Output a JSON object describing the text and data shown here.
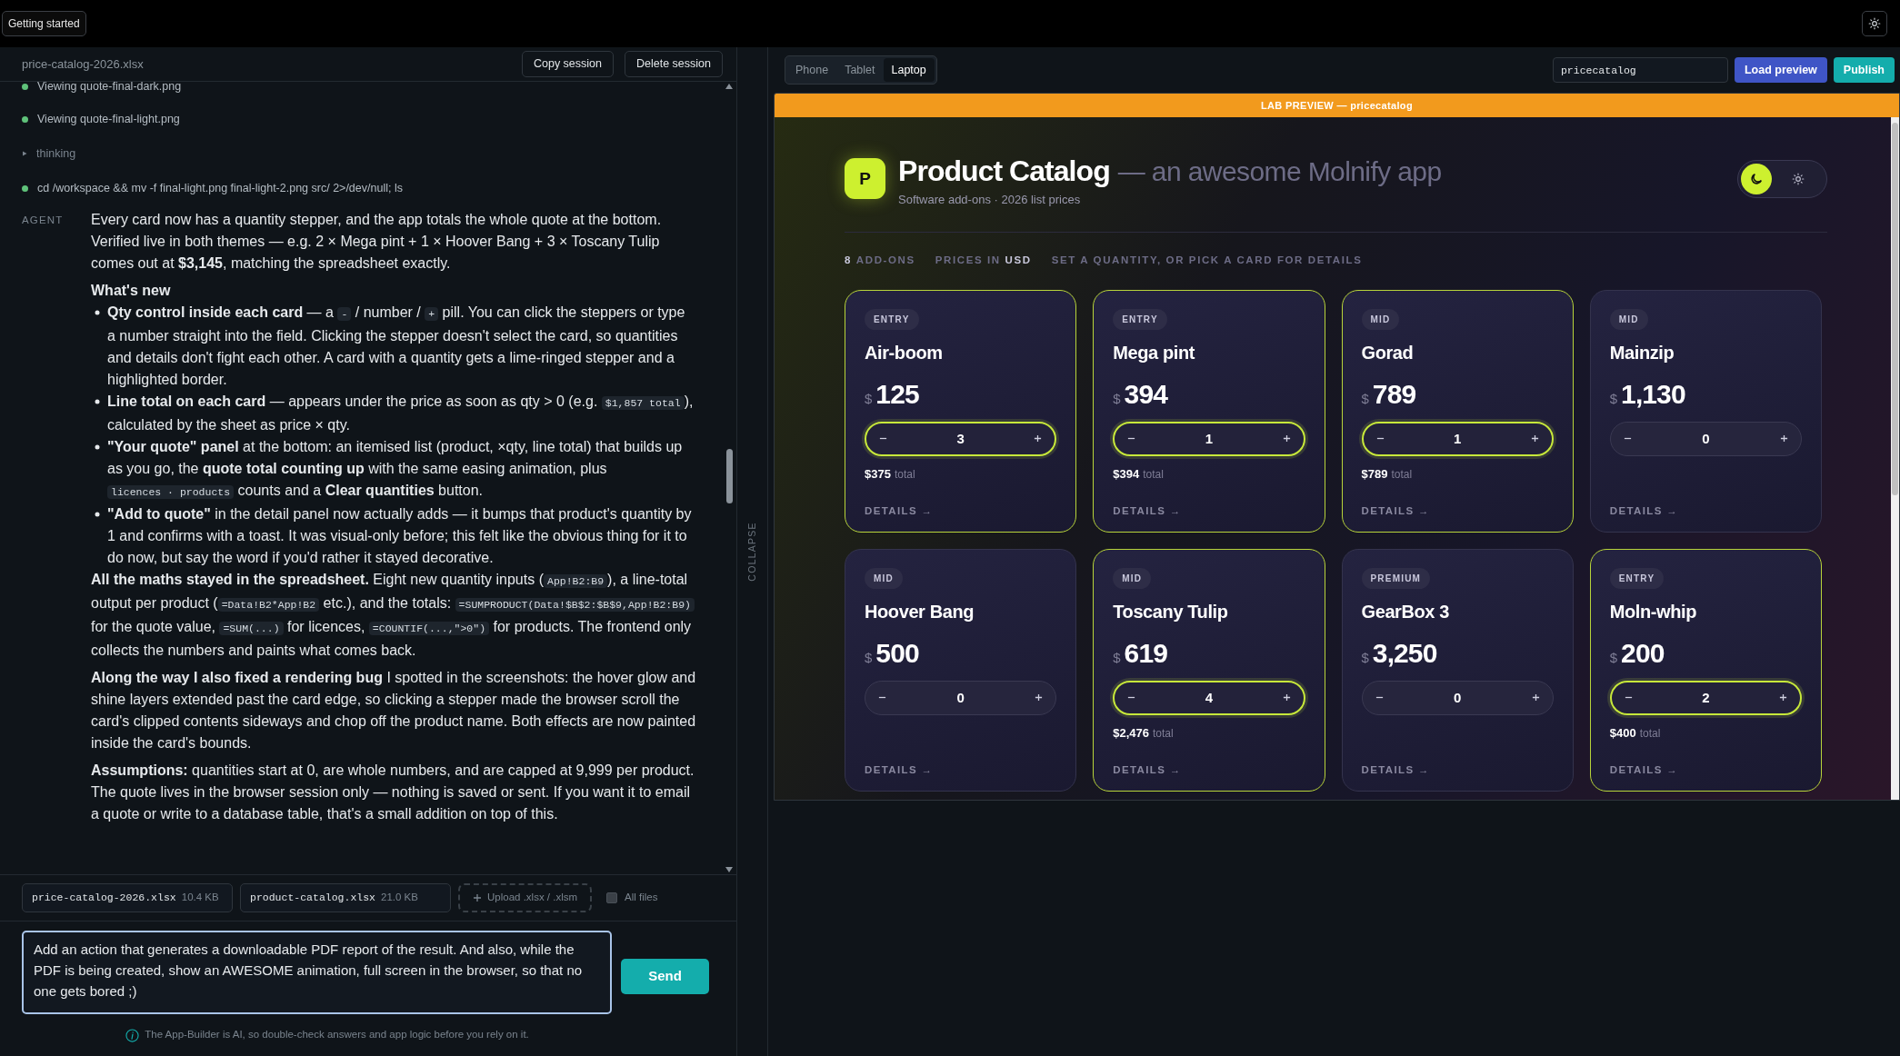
{
  "top_bar": {
    "guide_button": "Getting started"
  },
  "session": {
    "file_name": "price-catalog-2026.xlsx",
    "buttons": [
      "Copy session",
      "Delete session"
    ]
  },
  "chat": {
    "steps": [
      {
        "kind": "tool",
        "text": "Viewing quote-final-dark.png"
      },
      {
        "kind": "tool",
        "text": "Viewing quote-final-light.png"
      },
      {
        "kind": "thinking",
        "text": "thinking"
      },
      {
        "kind": "tool",
        "text": "cd /workspace && mv -f final-light.png final-light-2.png src/ 2>/dev/null; ls"
      }
    ],
    "agent_label": "AGENT",
    "blocks": [
      {
        "kind": "paragraph",
        "segments": [
          {
            "kind": "text",
            "text": "Every card now has a quantity stepper, and the app totals the whole quote at the bottom. Verified live in both themes — e.g. 2 × Mega pint + 1 × Hoover Bang + 3 × Toscany Tulip comes out at **$3,145**, matching the spreadsheet exactly."
          }
        ]
      },
      {
        "kind": "heading",
        "text": "What's new"
      },
      {
        "kind": "list",
        "items": [
          {
            "segments": [
              {
                "kind": "text",
                "text": "**Qty control inside each card** — a "
              },
              {
                "kind": "code",
                "text": "-"
              },
              {
                "kind": "text",
                "text": " / number / "
              },
              {
                "kind": "code",
                "text": "+"
              },
              {
                "kind": "text",
                "text": " pill. You can click the steppers or type a number straight into the field. Clicking the stepper doesn't select the card, so quantities and details don't fight each other. A card with a quantity gets a lime-ringed stepper and a highlighted border."
              }
            ]
          },
          {
            "segments": [
              {
                "kind": "text",
                "text": "**Line total on each card** — appears under the price as soon as qty > 0 (e.g. "
              },
              {
                "kind": "code",
                "text": "$1,857 total"
              },
              {
                "kind": "text",
                "text": "), calculated by the sheet as price × qty."
              }
            ]
          },
          {
            "segments": [
              {
                "kind": "text",
                "text": "**\"Your quote\" panel** at the bottom: an itemised list (product, ×qty, line total) that builds up as you go, the **quote total counting up** with the same easing animation, plus "
              },
              {
                "kind": "code",
                "text": "licences · products"
              },
              {
                "kind": "text",
                "text": " counts and a **Clear quantities** button."
              }
            ]
          },
          {
            "segments": [
              {
                "kind": "text",
                "text": "**\"Add to quote\"** in the detail panel now actually adds — it bumps that product's quantity by 1 and confirms with a toast. It was visual-only before; this felt like the obvious thing for it to do now, but say the word if you'd rather it stayed decorative."
              }
            ]
          }
        ]
      },
      {
        "kind": "paragraph",
        "segments": [
          {
            "kind": "text",
            "text": "**All the maths stayed in the spreadsheet.** Eight new quantity inputs ("
          },
          {
            "kind": "code",
            "text": "App!B2:B9"
          },
          {
            "kind": "text",
            "text": "), a line-total output per product ("
          },
          {
            "kind": "code",
            "text": "=Data!B2*App!B2"
          },
          {
            "kind": "text",
            "text": " etc.), and the totals: "
          },
          {
            "kind": "code",
            "text": "=SUMPRODUCT(Data!$B$2:$B$9,App!B2:B9)"
          },
          {
            "kind": "text",
            "text": " for the quote value, "
          },
          {
            "kind": "code",
            "text": "=SUM(...)"
          },
          {
            "kind": "text",
            "text": " for licences, "
          },
          {
            "kind": "code",
            "text": "=COUNTIF(...,\">0\")"
          },
          {
            "kind": "text",
            "text": " for products. The frontend only collects the numbers and paints what comes back."
          }
        ]
      },
      {
        "kind": "paragraph",
        "segments": [
          {
            "kind": "text",
            "text": "**Along the way I also fixed a rendering bug** I spotted in the screenshots: the hover glow and shine layers extended past the card edge, so clicking a stepper made the browser scroll the card's clipped contents sideways and chop off the product name. Both effects are now painted inside the card's bounds."
          }
        ]
      },
      {
        "kind": "paragraph",
        "segments": [
          {
            "kind": "text",
            "text": "**Assumptions:** quantities start at 0, are whole numbers, and are capped at 9,999 per product. The quote lives in the browser session only — nothing is saved or sent. If you want it to email a quote or write to a database table, that's a small addition on top of this."
          }
        ]
      }
    ]
  },
  "files": [
    {
      "name": "price-catalog-2026.xlsx",
      "size": "10.4 KB"
    },
    {
      "name": "product-catalog.xlsx",
      "size": "21.0 KB"
    }
  ],
  "upload": "Upload .xlsx / .xlsm",
  "all_files": {
    "label": "All files",
    "checked": false
  },
  "composer": {
    "value": "Add an action that generates a downloadable PDF report of the result. And also, while the PDF is being created, show an AWESOME animation, full screen in the browser, so that no one gets bored ;)",
    "send": "Send"
  },
  "disclaimer": "The App-Builder is AI, so double-check answers and app logic before you rely on it.",
  "collapse": "COLLAPSE",
  "preview_toolbar": {
    "devices": [
      {
        "label": "Phone",
        "selected": false
      },
      {
        "label": "Tablet",
        "selected": false
      },
      {
        "label": "Laptop",
        "selected": true
      }
    ],
    "app_name": "pricecatalog",
    "buttons": [
      "Load preview",
      "Publish"
    ]
  },
  "preview": {
    "banner": "LAB PREVIEW — pricecatalog",
    "logo": "P",
    "title": "Product Catalog",
    "tagline": "— an awesome Molnify app",
    "subtitle": "Software add-ons · 2026 list prices",
    "theme": [
      {
        "kind": "moon",
        "selected": true
      },
      {
        "kind": "sun",
        "selected": false
      }
    ],
    "stats": [
      {
        "value": "8",
        "label": "ADD-ONS"
      },
      {
        "label": "PRICES IN",
        "value": "USD"
      },
      {
        "label": "SET A QUANTITY, OR PICK A CARD FOR DETAILS"
      }
    ],
    "cards": [
      {
        "tier": "ENTRY",
        "name": "Air-boom",
        "currency": "$",
        "price": "125",
        "qty": "3",
        "total": "$375",
        "total_label": "total",
        "highlighted": true,
        "details": "DETAILS →"
      },
      {
        "tier": "ENTRY",
        "name": "Mega pint",
        "currency": "$",
        "price": "394",
        "qty": "1",
        "total": "$394",
        "total_label": "total",
        "highlighted": true,
        "details": "DETAILS →"
      },
      {
        "tier": "MID",
        "name": "Gorad",
        "currency": "$",
        "price": "789",
        "qty": "1",
        "total": "$789",
        "total_label": "total",
        "highlighted": true,
        "details": "DETAILS →"
      },
      {
        "tier": "MID",
        "name": "Mainzip",
        "currency": "$",
        "price": "1,130",
        "qty": "0",
        "highlighted": false,
        "details": "DETAILS →"
      },
      {
        "tier": "MID",
        "name": "Hoover Bang",
        "currency": "$",
        "price": "500",
        "qty": "0",
        "highlighted": false,
        "details": "DETAILS →"
      },
      {
        "tier": "MID",
        "name": "Toscany Tulip",
        "currency": "$",
        "price": "619",
        "qty": "4",
        "total": "$2,476",
        "total_label": "total",
        "highlighted": true,
        "details": "DETAILS →"
      },
      {
        "tier": "PREMIUM",
        "name": "GearBox 3",
        "currency": "$",
        "price": "3,250",
        "qty": "0",
        "highlighted": false,
        "details": "DETAILS →"
      },
      {
        "tier": "ENTRY",
        "name": "Moln-whip",
        "currency": "$",
        "price": "200",
        "qty": "2",
        "total": "$400",
        "total_label": "total",
        "highlighted": true,
        "details": "DETAILS →"
      }
    ]
  }
}
